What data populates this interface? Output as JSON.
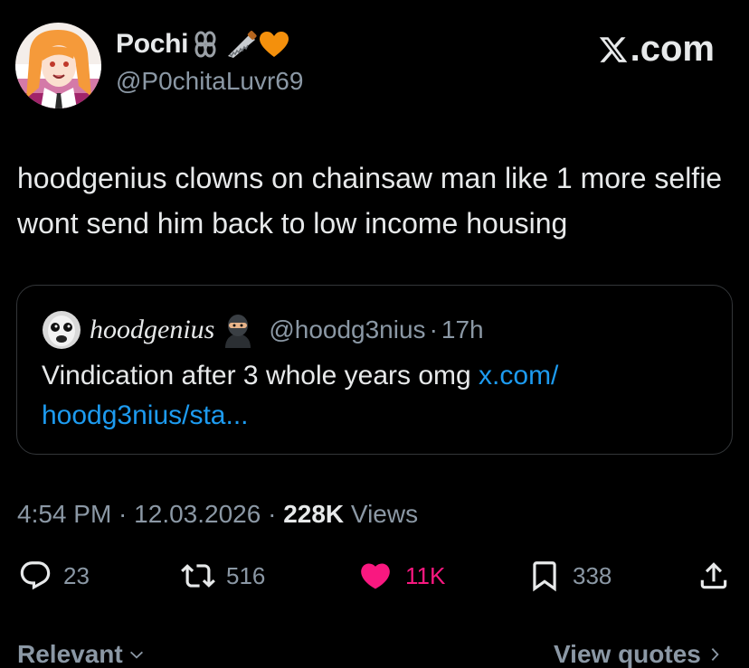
{
  "brand": {
    "site_label": ".com",
    "text_color": "#e7e9ea",
    "muted_color": "#8b98a5",
    "link_color": "#1d9bf0",
    "like_color": "#f91880"
  },
  "author": {
    "display_name": "Pochi",
    "name_emojis": [
      "chain-link-emoji",
      "saw-emoji",
      "orange-heart-emoji"
    ],
    "handle": "@P0chitaLuvr69"
  },
  "tweet": {
    "text": "hoodgenius clowns on chainsaw man like 1 more selfie wont send him back to low income housing"
  },
  "quoted_tweet": {
    "name": "hoodgenius",
    "name_emoji": "ninja-emoji",
    "handle": "@hoodg3nius",
    "separator": "·",
    "time": "17h",
    "text": "Vindication after 3 whole years omg ",
    "link_text": "x.com/ hoodg3nius/sta..."
  },
  "meta": {
    "time": "4:54 PM",
    "sep1": " · ",
    "date": "12.03.2026",
    "sep2": " · ",
    "views_count": "228K",
    "views_label": " Views"
  },
  "actions": {
    "replies": "23",
    "reposts": "516",
    "likes": "11K",
    "bookmarks": "338"
  },
  "footer": {
    "sort_label": "Relevant",
    "quotes_label": "View quotes"
  }
}
